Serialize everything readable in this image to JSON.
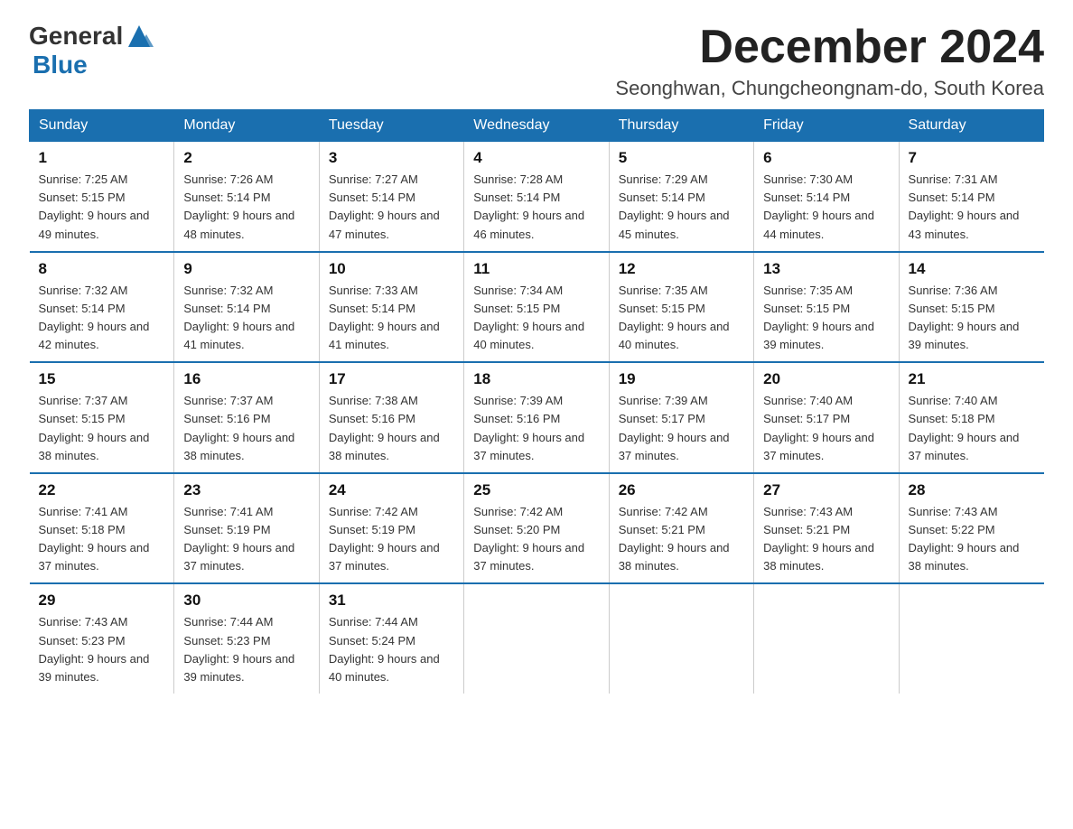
{
  "header": {
    "logo_general": "General",
    "logo_blue": "Blue",
    "month_title": "December 2024",
    "location": "Seonghwan, Chungcheongnam-do, South Korea"
  },
  "weekdays": [
    "Sunday",
    "Monday",
    "Tuesday",
    "Wednesday",
    "Thursday",
    "Friday",
    "Saturday"
  ],
  "weeks": [
    [
      {
        "day": "1",
        "sunrise": "7:25 AM",
        "sunset": "5:15 PM",
        "daylight": "9 hours and 49 minutes."
      },
      {
        "day": "2",
        "sunrise": "7:26 AM",
        "sunset": "5:14 PM",
        "daylight": "9 hours and 48 minutes."
      },
      {
        "day": "3",
        "sunrise": "7:27 AM",
        "sunset": "5:14 PM",
        "daylight": "9 hours and 47 minutes."
      },
      {
        "day": "4",
        "sunrise": "7:28 AM",
        "sunset": "5:14 PM",
        "daylight": "9 hours and 46 minutes."
      },
      {
        "day": "5",
        "sunrise": "7:29 AM",
        "sunset": "5:14 PM",
        "daylight": "9 hours and 45 minutes."
      },
      {
        "day": "6",
        "sunrise": "7:30 AM",
        "sunset": "5:14 PM",
        "daylight": "9 hours and 44 minutes."
      },
      {
        "day": "7",
        "sunrise": "7:31 AM",
        "sunset": "5:14 PM",
        "daylight": "9 hours and 43 minutes."
      }
    ],
    [
      {
        "day": "8",
        "sunrise": "7:32 AM",
        "sunset": "5:14 PM",
        "daylight": "9 hours and 42 minutes."
      },
      {
        "day": "9",
        "sunrise": "7:32 AM",
        "sunset": "5:14 PM",
        "daylight": "9 hours and 41 minutes."
      },
      {
        "day": "10",
        "sunrise": "7:33 AM",
        "sunset": "5:14 PM",
        "daylight": "9 hours and 41 minutes."
      },
      {
        "day": "11",
        "sunrise": "7:34 AM",
        "sunset": "5:15 PM",
        "daylight": "9 hours and 40 minutes."
      },
      {
        "day": "12",
        "sunrise": "7:35 AM",
        "sunset": "5:15 PM",
        "daylight": "9 hours and 40 minutes."
      },
      {
        "day": "13",
        "sunrise": "7:35 AM",
        "sunset": "5:15 PM",
        "daylight": "9 hours and 39 minutes."
      },
      {
        "day": "14",
        "sunrise": "7:36 AM",
        "sunset": "5:15 PM",
        "daylight": "9 hours and 39 minutes."
      }
    ],
    [
      {
        "day": "15",
        "sunrise": "7:37 AM",
        "sunset": "5:15 PM",
        "daylight": "9 hours and 38 minutes."
      },
      {
        "day": "16",
        "sunrise": "7:37 AM",
        "sunset": "5:16 PM",
        "daylight": "9 hours and 38 minutes."
      },
      {
        "day": "17",
        "sunrise": "7:38 AM",
        "sunset": "5:16 PM",
        "daylight": "9 hours and 38 minutes."
      },
      {
        "day": "18",
        "sunrise": "7:39 AM",
        "sunset": "5:16 PM",
        "daylight": "9 hours and 37 minutes."
      },
      {
        "day": "19",
        "sunrise": "7:39 AM",
        "sunset": "5:17 PM",
        "daylight": "9 hours and 37 minutes."
      },
      {
        "day": "20",
        "sunrise": "7:40 AM",
        "sunset": "5:17 PM",
        "daylight": "9 hours and 37 minutes."
      },
      {
        "day": "21",
        "sunrise": "7:40 AM",
        "sunset": "5:18 PM",
        "daylight": "9 hours and 37 minutes."
      }
    ],
    [
      {
        "day": "22",
        "sunrise": "7:41 AM",
        "sunset": "5:18 PM",
        "daylight": "9 hours and 37 minutes."
      },
      {
        "day": "23",
        "sunrise": "7:41 AM",
        "sunset": "5:19 PM",
        "daylight": "9 hours and 37 minutes."
      },
      {
        "day": "24",
        "sunrise": "7:42 AM",
        "sunset": "5:19 PM",
        "daylight": "9 hours and 37 minutes."
      },
      {
        "day": "25",
        "sunrise": "7:42 AM",
        "sunset": "5:20 PM",
        "daylight": "9 hours and 37 minutes."
      },
      {
        "day": "26",
        "sunrise": "7:42 AM",
        "sunset": "5:21 PM",
        "daylight": "9 hours and 38 minutes."
      },
      {
        "day": "27",
        "sunrise": "7:43 AM",
        "sunset": "5:21 PM",
        "daylight": "9 hours and 38 minutes."
      },
      {
        "day": "28",
        "sunrise": "7:43 AM",
        "sunset": "5:22 PM",
        "daylight": "9 hours and 38 minutes."
      }
    ],
    [
      {
        "day": "29",
        "sunrise": "7:43 AM",
        "sunset": "5:23 PM",
        "daylight": "9 hours and 39 minutes."
      },
      {
        "day": "30",
        "sunrise": "7:44 AM",
        "sunset": "5:23 PM",
        "daylight": "9 hours and 39 minutes."
      },
      {
        "day": "31",
        "sunrise": "7:44 AM",
        "sunset": "5:24 PM",
        "daylight": "9 hours and 40 minutes."
      },
      null,
      null,
      null,
      null
    ]
  ]
}
